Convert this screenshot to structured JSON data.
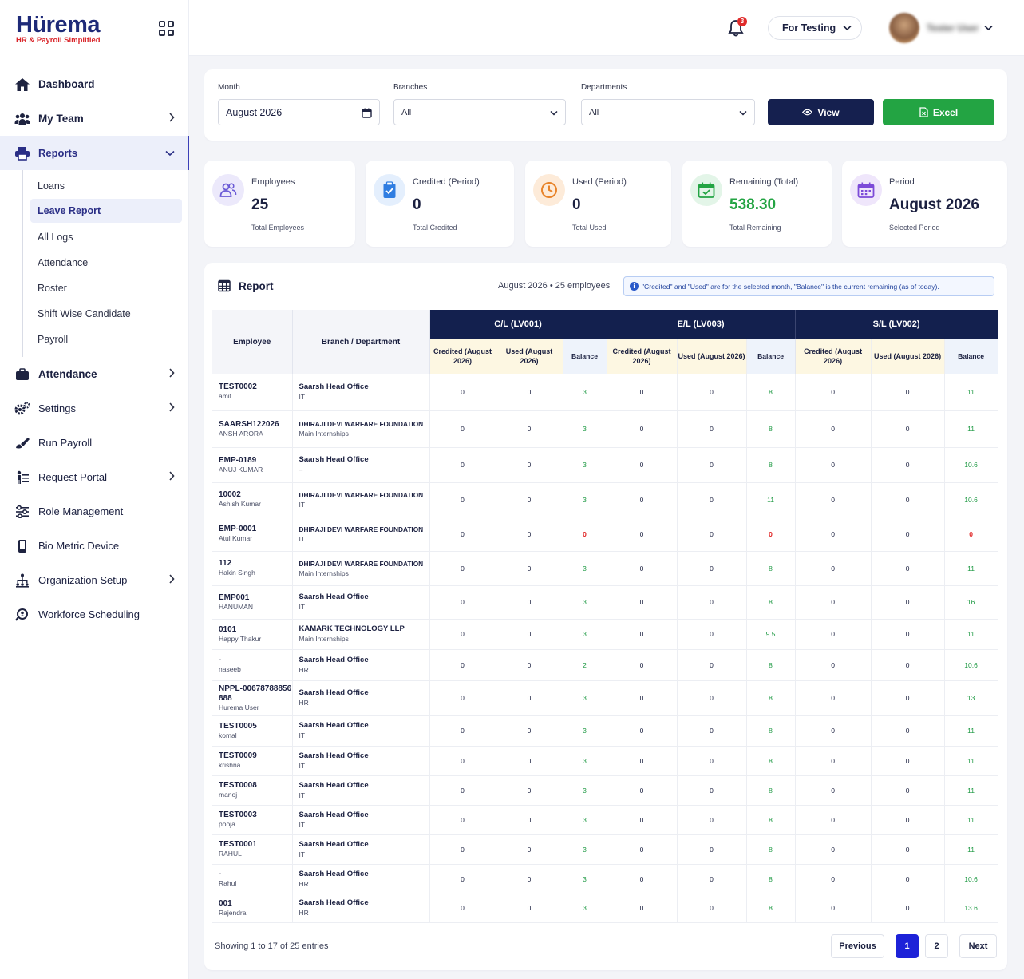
{
  "brand": {
    "name": "Hürema",
    "tagline": "HR & Payroll Simplified"
  },
  "sidebar": {
    "items": [
      {
        "label": "Dashboard",
        "icon": "home-icon"
      },
      {
        "label": "My Team",
        "icon": "team-icon"
      },
      {
        "label": "Reports",
        "icon": "printer-icon"
      },
      {
        "label": "Attendance",
        "icon": "briefcase-icon"
      },
      {
        "label": "Settings",
        "icon": "gears-icon"
      },
      {
        "label": "Run Payroll",
        "icon": "brush-icon"
      },
      {
        "label": "Request Portal",
        "icon": "request-icon"
      },
      {
        "label": "Role Management",
        "icon": "sliders-icon"
      },
      {
        "label": "Bio Metric Device",
        "icon": "phone-icon"
      },
      {
        "label": "Organization Setup",
        "icon": "org-icon"
      },
      {
        "label": "Workforce Scheduling",
        "icon": "search-person-icon"
      }
    ],
    "reports_sub": [
      "Loans",
      "Leave Report",
      "All Logs",
      "Attendance",
      "Roster",
      "Shift Wise Candidate",
      "Payroll"
    ]
  },
  "topbar": {
    "notifications": "3",
    "company": "For Testing",
    "user": "Tester User"
  },
  "filters": {
    "month_label": "Month",
    "month_value": "August 2026",
    "branches_label": "Branches",
    "branches_value": "All",
    "departments_label": "Departments",
    "departments_value": "All",
    "view_label": "View",
    "excel_label": "Excel"
  },
  "stats": [
    {
      "title": "Employees",
      "value": "25",
      "sub": "Total Employees",
      "color": "#6b5bd6"
    },
    {
      "title": "Credited (Period)",
      "value": "0",
      "sub": "Total Credited",
      "color": "#2f7de1"
    },
    {
      "title": "Used (Period)",
      "value": "0",
      "sub": "Total Used",
      "color": "#e8842a"
    },
    {
      "title": "Remaining (Total)",
      "value": "538.30",
      "sub": "Total Remaining",
      "color": "#23a443"
    },
    {
      "title": "Period",
      "value": "August 2026",
      "sub": "Selected Period",
      "color": "#7c4ad8"
    }
  ],
  "report": {
    "title": "Report",
    "meta": "August 2026 • 25 employees",
    "info": "\"Credited\" and \"Used\" are for the selected month, \"Balance\" is the current remaining (as of today).",
    "col_employee": "Employee",
    "col_branch": "Branch / Department",
    "groups": [
      "C/L (LV001)",
      "E/L (LV003)",
      "S/L (LV002)"
    ],
    "sub_credited": "Credited (August 2026)",
    "sub_used": "Used (August 2026)",
    "sub_balance": "Balance",
    "rows": [
      {
        "id": "TEST0002",
        "name": "amit",
        "branch": "Saarsh Head Office",
        "dept": "IT",
        "cl": "3",
        "el": "8",
        "sl": "11"
      },
      {
        "id": "SAARSH122026",
        "name": "ANSH ARORA",
        "branch": "DHIRAJI DEVI WARFARE FOUNDATION",
        "dept": "Main Internships",
        "cl": "3",
        "el": "8",
        "sl": "11"
      },
      {
        "id": "EMP-0189",
        "name": "ANUJ KUMAR",
        "branch": "Saarsh Head Office",
        "dept": "–",
        "cl": "3",
        "el": "8",
        "sl": "10.6"
      },
      {
        "id": "10002",
        "name": "Ashish Kumar",
        "branch": "DHIRAJI DEVI WARFARE FOUNDATION",
        "dept": "IT",
        "cl": "3",
        "el": "11",
        "sl": "10.6"
      },
      {
        "id": "EMP-0001",
        "name": "Atul Kumar",
        "branch": "DHIRAJI DEVI WARFARE FOUNDATION",
        "dept": "IT",
        "cl": "0",
        "el": "0",
        "sl": "0"
      },
      {
        "id": "112",
        "name": "Hakin Singh",
        "branch": "DHIRAJI DEVI WARFARE FOUNDATION",
        "dept": "Main Internships",
        "cl": "3",
        "el": "8",
        "sl": "11"
      },
      {
        "id": "EMP001",
        "name": "HANUMAN",
        "branch": "Saarsh Head Office",
        "dept": "IT",
        "cl": "3",
        "el": "8",
        "sl": "16"
      },
      {
        "id": "0101",
        "name": "Happy Thakur",
        "branch": "KAMARK TECHNOLOGY LLP",
        "dept": "Main Internships",
        "cl": "3",
        "el": "9.5",
        "sl": "11"
      },
      {
        "id": "-",
        "name": "naseeb",
        "branch": "Saarsh Head Office",
        "dept": "HR",
        "cl": "2",
        "el": "8",
        "sl": "10.6"
      },
      {
        "id": "NPPL-00678788856888",
        "name": "Hurema User",
        "branch": "Saarsh Head Office",
        "dept": "HR",
        "cl": "3",
        "el": "8",
        "sl": "13"
      },
      {
        "id": "TEST0005",
        "name": "komal",
        "branch": "Saarsh Head Office",
        "dept": "IT",
        "cl": "3",
        "el": "8",
        "sl": "11"
      },
      {
        "id": "TEST0009",
        "name": "krishna",
        "branch": "Saarsh Head Office",
        "dept": "IT",
        "cl": "3",
        "el": "8",
        "sl": "11"
      },
      {
        "id": "TEST0008",
        "name": "manoj",
        "branch": "Saarsh Head Office",
        "dept": "IT",
        "cl": "3",
        "el": "8",
        "sl": "11"
      },
      {
        "id": "TEST0003",
        "name": "pooja",
        "branch": "Saarsh Head Office",
        "dept": "IT",
        "cl": "3",
        "el": "8",
        "sl": "11"
      },
      {
        "id": "TEST0001",
        "name": "RAHUL",
        "branch": "Saarsh Head Office",
        "dept": "IT",
        "cl": "3",
        "el": "8",
        "sl": "11"
      },
      {
        "id": "-",
        "name": "Rahul",
        "branch": "Saarsh Head Office",
        "dept": "HR",
        "cl": "3",
        "el": "8",
        "sl": "10.6"
      },
      {
        "id": "001",
        "name": "Rajendra",
        "branch": "Saarsh Head Office",
        "dept": "HR",
        "cl": "3",
        "el": "8",
        "sl": "13.6"
      }
    ],
    "zero": "0",
    "showing": "Showing 1 to 17 of 25 entries",
    "pagination": {
      "prev": "Previous",
      "pages": [
        "1",
        "2"
      ],
      "next": "Next"
    }
  }
}
